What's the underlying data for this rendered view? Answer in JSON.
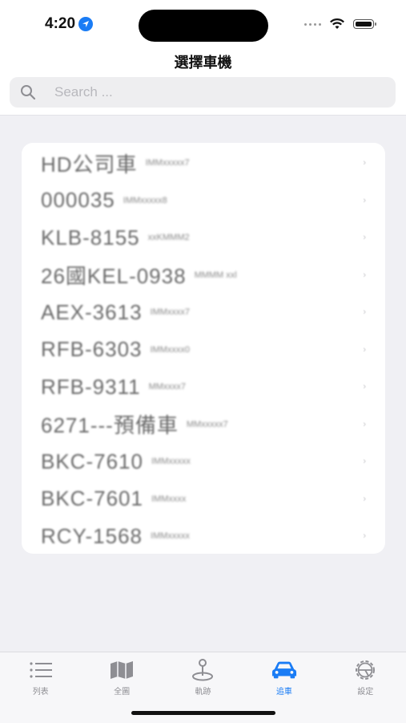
{
  "status_bar": {
    "time": "4:20",
    "icons": [
      "location-arrow-icon",
      "cellular-dots-icon",
      "wifi-icon",
      "battery-icon"
    ]
  },
  "header": {
    "title": "選擇車機"
  },
  "search": {
    "placeholder": "Search ..."
  },
  "vehicles": [
    {
      "plate": "HD公司車",
      "model": "IMMxxxxx7"
    },
    {
      "plate": "000035",
      "model": "IMMxxxxx8"
    },
    {
      "plate": "KLB-8155",
      "model": "xxKMMM2"
    },
    {
      "plate": "26國KEL-0938",
      "model": "MMMM xxl"
    },
    {
      "plate": "AEX-3613",
      "model": "IMMxxxx7"
    },
    {
      "plate": "RFB-6303",
      "model": "IMMxxxx0"
    },
    {
      "plate": "RFB-9311",
      "model": "MMxxxx7"
    },
    {
      "plate": "6271---預備車",
      "model": "MMxxxxx7"
    },
    {
      "plate": "BKC-7610",
      "model": "IMMxxxxx"
    },
    {
      "plate": "BKC-7601",
      "model": "IMMxxxx"
    },
    {
      "plate": "RCY-1568",
      "model": "IMMxxxxx"
    }
  ],
  "row_chevron": "›",
  "tabs": [
    {
      "label": "列表",
      "icon": "list-icon",
      "active": false
    },
    {
      "label": "全圖",
      "icon": "map-icon",
      "active": false
    },
    {
      "label": "軌跡",
      "icon": "track-pin-icon",
      "active": false
    },
    {
      "label": "追車",
      "icon": "car-icon",
      "active": true
    },
    {
      "label": "設定",
      "icon": "gear-icon",
      "active": false
    }
  ],
  "colors": {
    "accent": "#1a7cf5",
    "inactive": "#8e8e93",
    "background": "#f0f0f4"
  }
}
